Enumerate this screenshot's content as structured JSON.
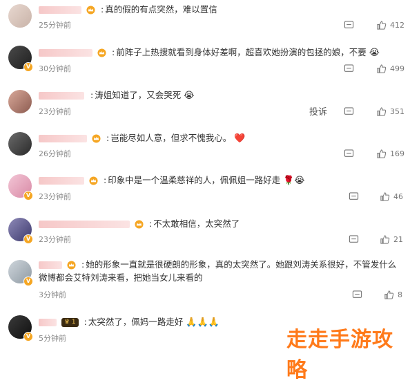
{
  "comments": [
    {
      "text": "真的假的有点突然，难以置信",
      "time": "25分钟前",
      "likes": "412",
      "emoji": ""
    },
    {
      "text": "前阵子上热搜就看到身体好差啊，超喜欢她扮演的包拯的娘，不要",
      "time": "30分钟前",
      "likes": "499",
      "emoji": "😭"
    },
    {
      "text": "涛姐知道了，又会哭死",
      "time": "23分钟前",
      "likes": "351",
      "emoji": "😭",
      "report": "投诉"
    },
    {
      "text": "岂能尽如人意，但求不愧我心。",
      "time": "26分钟前",
      "likes": "169",
      "emoji": "❤️"
    },
    {
      "text": "印象中是一个温柔慈祥的人，佩佩姐一路好走",
      "time": "23分钟前",
      "likes": "46",
      "emoji": "🌹😭"
    },
    {
      "text": "不太敢相信，太突然了",
      "time": "23分钟前",
      "likes": "21",
      "emoji": ""
    },
    {
      "text": "她的形象一直就是很硬朗的形象，真的太突然了。她跟刘涛关系很好，不管发什么微博都会艾特刘涛来看，把她当女儿来看的",
      "time": "3分钟前",
      "likes": "8",
      "emoji": ""
    },
    {
      "text": "太突然了，佩妈一路走好",
      "time": "5分钟前",
      "likes": "",
      "emoji": "🙏🙏🙏",
      "level": "1"
    }
  ],
  "watermark": "走走手游攻略",
  "colors": {
    "crown": "#f5a623",
    "watermark": "#ff7a1a",
    "vip": "#f5a623"
  }
}
